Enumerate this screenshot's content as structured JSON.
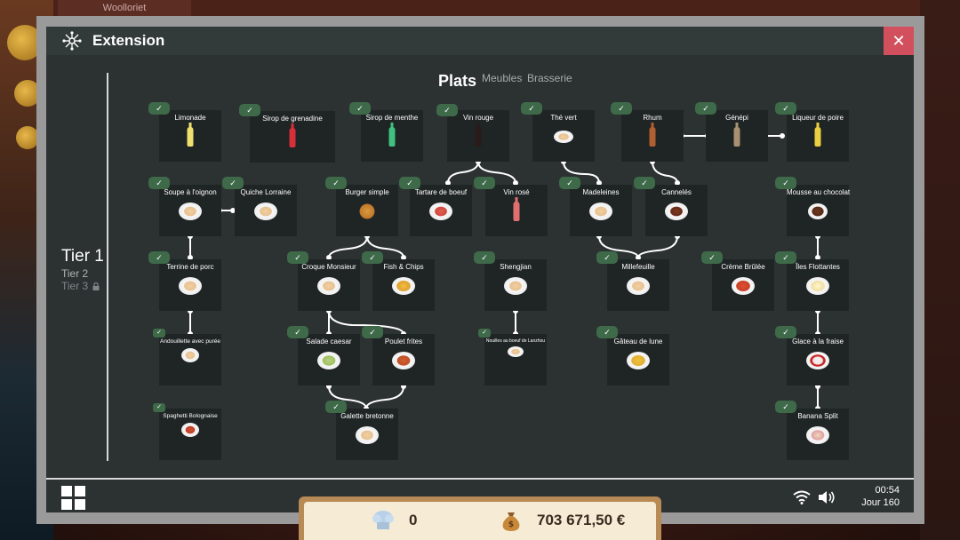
{
  "window": {
    "title": "Extension",
    "close": "✕",
    "icon": "network-icon"
  },
  "tiers": [
    "Tier 1",
    "Tier 2",
    "Tier 3"
  ],
  "tabs": [
    {
      "label": "Plats"
    },
    {
      "label": "Meubles"
    },
    {
      "label": "Brasserie"
    }
  ],
  "recipes": {
    "limonade": "Limonade",
    "sirop_grenadine": "Sirop de grenadine",
    "sirop_menthe": "Sirop de menthe",
    "vin_rouge": "Vin rouge",
    "the_vert": "Thé vert",
    "rhum": "Rhum",
    "genepi": "Génépi",
    "liqueur_poire": "Liqueur de poire",
    "soupe_oignon": "Soupe à l'oignon",
    "quiche": "Quiche Lorraine",
    "burger": "Burger simple",
    "tartare": "Tartare de boeuf",
    "vin_rose": "Vin rosé",
    "madeleines": "Madeleines",
    "canneles": "Cannelés",
    "mousse": "Mousse au chocolat",
    "terrine": "Terrine de porc",
    "croque": "Croque Monsieur",
    "fish": "Fish & Chips",
    "shengjian": "Shengjian",
    "millefeuille": "Millefeuille",
    "creme_brulee": "Crème Brûlée",
    "iles": "Îles Flottantes",
    "andouillette": "Andouillette avec purée",
    "salade": "Salade caesar",
    "poulet": "Poulet frites",
    "nouilles": "Nouilles au boeuf de Lanzhou",
    "gateau_lune": "Gâteau de lune",
    "glace_fraise": "Glace à la fraise",
    "spaghetti": "Spaghetti Bolognaise",
    "galette": "Galette bretonne",
    "banana_split": "Banana Split"
  },
  "check_glyph": "✓",
  "status": {
    "time": "00:54",
    "day": "Jour 160"
  },
  "currency": {
    "chefs": "0",
    "money": "703 671,50 €"
  },
  "background": {
    "tab": "Woolloriet"
  },
  "colors": {
    "panel": "#2c3131",
    "card": "#1f2424",
    "check": "#3e6a4a",
    "close": "#d2505e"
  }
}
